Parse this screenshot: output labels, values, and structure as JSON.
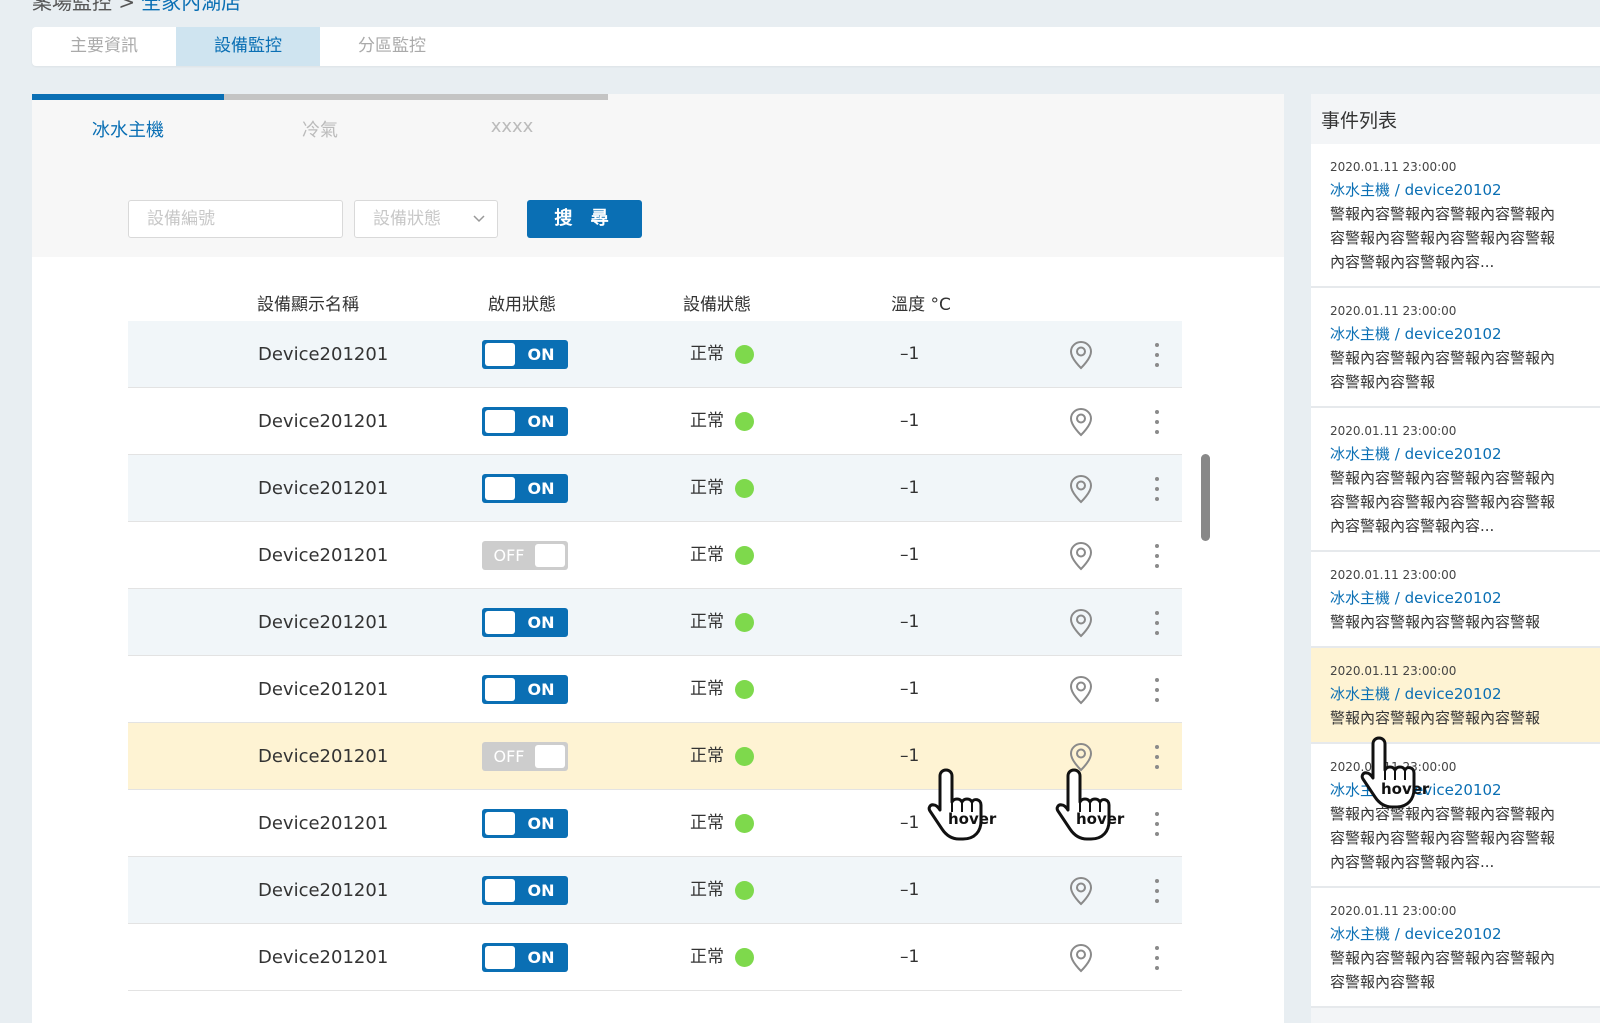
{
  "breadcrumb": {
    "parent": "案場監控 >",
    "current": "全家內湖店"
  },
  "main_tabs": [
    "主要資訊",
    "設備監控",
    "分區監控"
  ],
  "sub_tabs": [
    "冰水主機",
    "冷氣",
    "xxxx"
  ],
  "filters": {
    "device_id_placeholder": "設備編號",
    "device_status_placeholder": "設備狀態",
    "search_label": "搜 尋"
  },
  "table": {
    "headers": [
      "設備顯示名稱",
      "啟用狀態",
      "設備狀態",
      "溫度 °C"
    ],
    "rows": [
      {
        "name": "Device201201",
        "enabled": "ON",
        "status": "正常",
        "temp": "–1"
      },
      {
        "name": "Device201201",
        "enabled": "ON",
        "status": "正常",
        "temp": "–1"
      },
      {
        "name": "Device201201",
        "enabled": "ON",
        "status": "正常",
        "temp": "–1"
      },
      {
        "name": "Device201201",
        "enabled": "OFF",
        "status": "正常",
        "temp": "–1"
      },
      {
        "name": "Device201201",
        "enabled": "ON",
        "status": "正常",
        "temp": "–1"
      },
      {
        "name": "Device201201",
        "enabled": "ON",
        "status": "正常",
        "temp": "–1"
      },
      {
        "name": "Device201201",
        "enabled": "OFF",
        "status": "正常",
        "temp": "–1"
      },
      {
        "name": "Device201201",
        "enabled": "ON",
        "status": "正常",
        "temp": "–1"
      },
      {
        "name": "Device201201",
        "enabled": "ON",
        "status": "正常",
        "temp": "–1"
      },
      {
        "name": "Device201201",
        "enabled": "ON",
        "status": "正常",
        "temp": "–1"
      }
    ]
  },
  "events": {
    "title": "事件列表",
    "items": [
      {
        "time": "2020.01.11  23:00:00",
        "title": "冰水主機 / device20102",
        "lines": [
          "警報內容警報內容警報內容警報內",
          "容警報內容警報內容警報內容警報",
          "內容警報內容警報內容..."
        ]
      },
      {
        "time": "2020.01.11  23:00:00",
        "title": "冰水主機 / device20102",
        "lines": [
          "警報內容警報內容警報內容警報內",
          "容警報內容警報"
        ]
      },
      {
        "time": "2020.01.11  23:00:00",
        "title": "冰水主機 / device20102",
        "lines": [
          "警報內容警報內容警報內容警報內",
          "容警報內容警報內容警報內容警報",
          "內容警報內容警報內容..."
        ]
      },
      {
        "time": "2020.01.11  23:00:00",
        "title": "冰水主機 / device20102",
        "lines": [
          "警報內容警報內容警報內容警報"
        ]
      },
      {
        "time": "2020.01.11  23:00:00",
        "title": "冰水主機 / device20102",
        "lines": [
          "警報內容警報內容警報內容警報"
        ]
      },
      {
        "time": "2020.01.11  23:00:00",
        "title": "冰水主機 / device20102",
        "lines": [
          "警報內容警報內容警報內容警報內",
          "容警報內容警報內容警報內容警報",
          "內容警報內容警報內容..."
        ]
      },
      {
        "time": "2020.01.11  23:00:00",
        "title": "冰水主機 / device20102",
        "lines": [
          "警報內容警報內容警報內容警報內",
          "容警報內容警報"
        ]
      }
    ]
  },
  "cursor_label": "hover",
  "colors": {
    "primary": "#0a6fb4",
    "highlight": "#fef3d3",
    "row_alt": "#f1f6f9",
    "status_ok": "#7ed94c",
    "toggle_off": "#cdcdcd"
  }
}
